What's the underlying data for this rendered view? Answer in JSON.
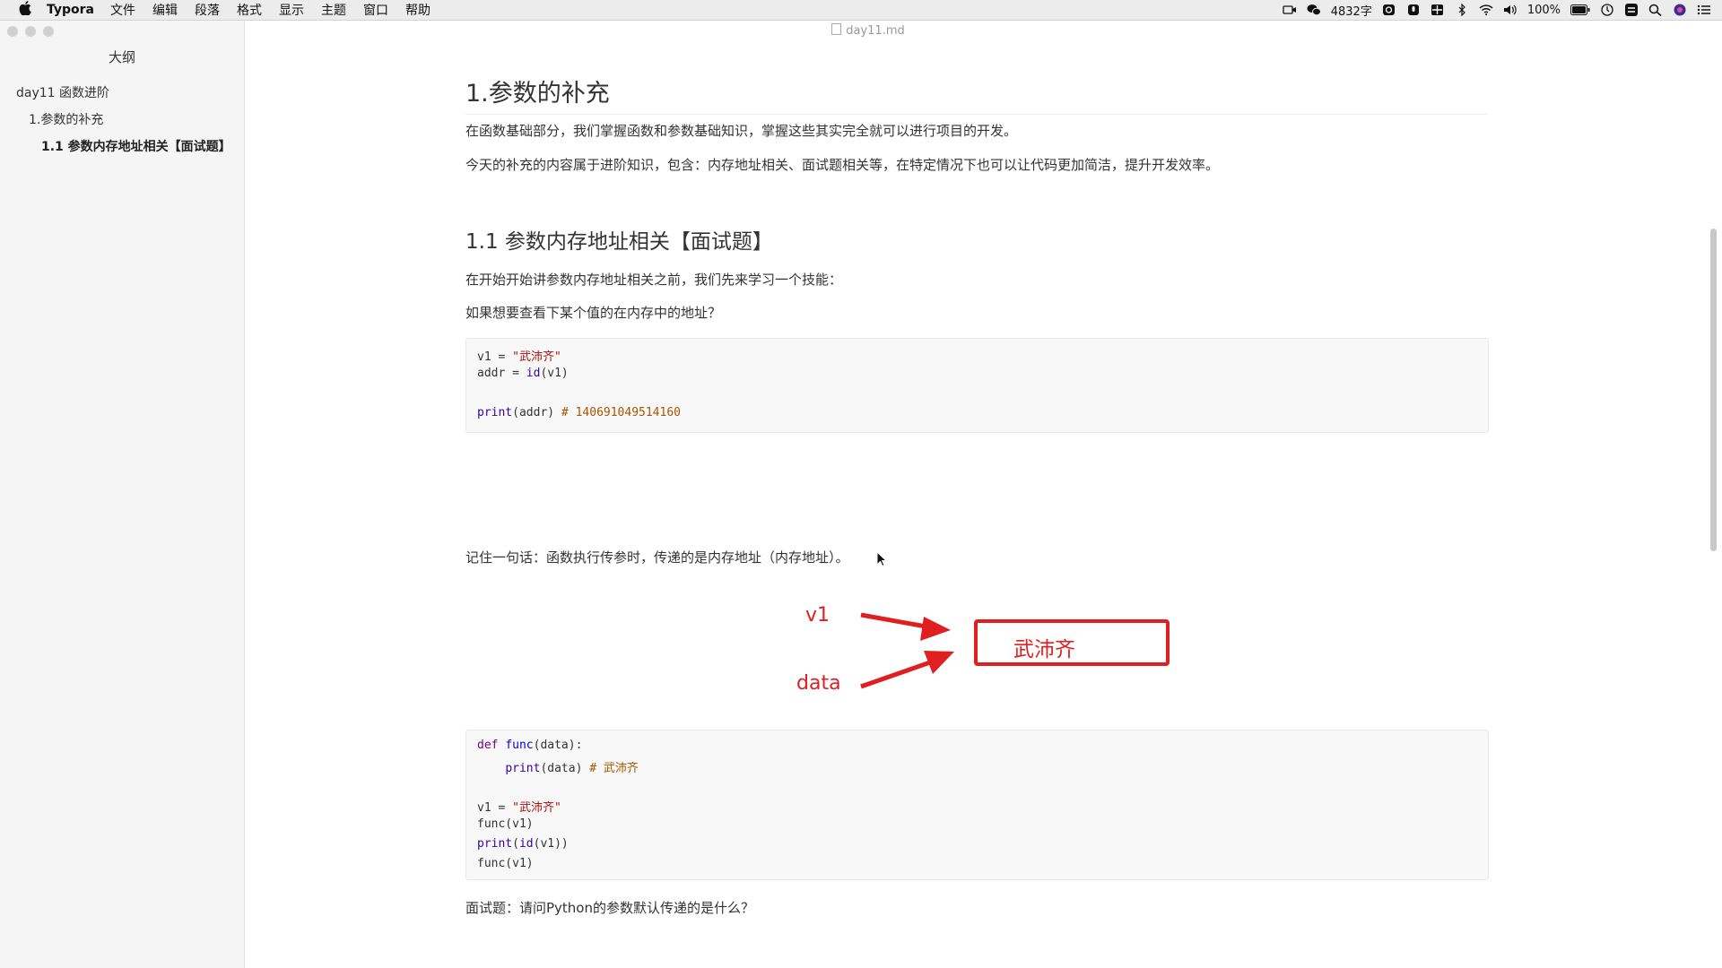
{
  "menubar": {
    "app": "Typora",
    "menus": [
      "文件",
      "编辑",
      "段落",
      "格式",
      "显示",
      "主题",
      "窗口",
      "帮助"
    ],
    "word_count": "4832字",
    "battery": "100%"
  },
  "sidebar": {
    "title": "大纲",
    "items": [
      {
        "label": "day11 函数进阶"
      },
      {
        "label": "1.参数的补充"
      },
      {
        "label": "1.1 参数内存地址相关【面试题】"
      }
    ]
  },
  "editor": {
    "filename": "day11.md",
    "h2": "1.参数的补充",
    "p1": "在函数基础部分，我们掌握函数和参数基础知识，掌握这些其实完全就可以进行项目的开发。",
    "p2": "今天的补充的内容属于进阶知识，包含：内存地址相关、面试题相关等，在特定情况下也可以让代码更加简洁，提升开发效率。",
    "h3": "1.1 参数内存地址相关【面试题】",
    "p3": "在开始开始讲参数内存地址相关之前，我们先来学习一个技能：",
    "p4": "如果想要查看下某个值的在内存中的地址？",
    "code1": {
      "l1_var": "v1",
      "l1_eq": " = ",
      "l1_str": "\"武沛齐\"",
      "l2_var": "addr",
      "l2_eq": " = ",
      "l2_fn": "id",
      "l2_args": "(v1)",
      "l4_fn": "print",
      "l4_args": "(addr) ",
      "l4_comment": "# 140691049514160"
    },
    "p5": "记住一句话：函数执行传参时，传递的是内存地址（内存地址）。",
    "diagram": {
      "label_v1": "v1",
      "label_data": "data",
      "box_value": "武沛齐"
    },
    "code2": {
      "l1_kw": "def",
      "l1_fn": "func",
      "l1_rest": "(data):",
      "l2_fn": "print",
      "l2_args": "(data) ",
      "l2_comment": "# 武沛齐",
      "l4_var": "v1",
      "l4_eq": " = ",
      "l4_str": "\"武沛齐\"",
      "l5": "func(v1)",
      "l6_fn": "print",
      "l6_mid": "(",
      "l6_fn2": "id",
      "l6_rest": "(v1))",
      "l7": "func(v1)"
    },
    "p6": "面试题：请问Python的参数默认传递的是什么？"
  }
}
